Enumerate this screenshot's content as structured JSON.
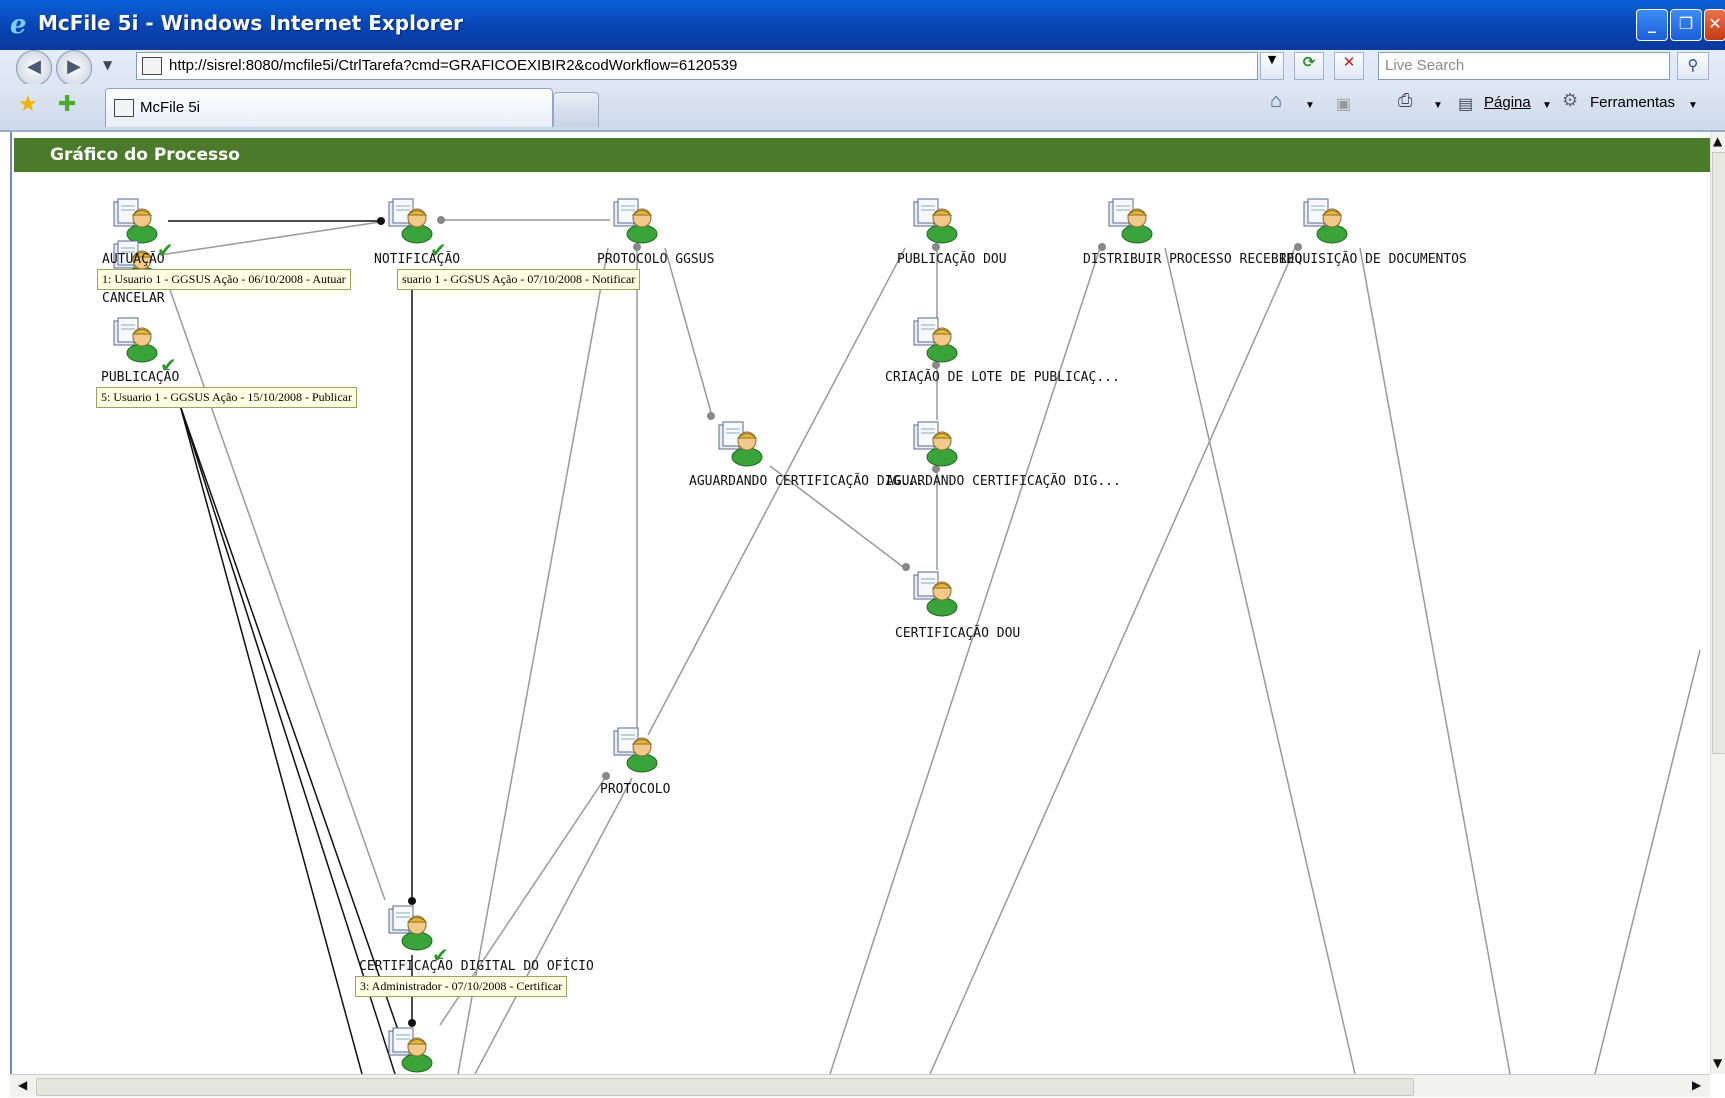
{
  "window": {
    "title": "McFile 5i - Windows Internet Explorer"
  },
  "browser": {
    "url": "http://sisrel:8080/mcfile5i/CtrlTarefa?cmd=GRAFICOEXIBIR2&codWorkflow=6120539",
    "search_placeholder": "Live Search",
    "tab_label": "McFile 5i",
    "menu_pagina": "Página",
    "menu_ferramentas": "Ferramentas"
  },
  "page": {
    "header": "Gráfico do Processo"
  },
  "nodes": [
    {
      "label": "AUTUAÇÃO"
    },
    {
      "label": "NOTIFICAÇÃO"
    },
    {
      "label": "PROTOCOLO GGSUS"
    },
    {
      "label": "PUBLICAÇÃO DOU"
    },
    {
      "label": "DISTRIBUIR PROCESSO RECEBIDO"
    },
    {
      "label": "REQUISIÇÃO DE DOCUMENTOS"
    },
    {
      "label": "CANCELAR"
    },
    {
      "label": "PUBLICAÇÃO"
    },
    {
      "label": "CRIAÇÃO DE LOTE DE PUBLICAÇ..."
    },
    {
      "label": "AGUARDANDO CERTIFICAÇÃO DIG..."
    },
    {
      "label": "AGUARDANDO CERTIFICAÇÃO DIG..."
    },
    {
      "label": "CERTIFICAÇÃO DOU"
    },
    {
      "label": "PROTOCOLO"
    },
    {
      "label": "CERTIFICAÇÃO DIGITAL DO OFÍCIO"
    }
  ],
  "tooltips": [
    "1: Usuario 1 - GGSUS Ação - 06/10/2008 - Autuar",
    "suario 1 - GGSUS Ação - 07/10/2008 - Notificar",
    "5: Usuario 1 - GGSUS Ação - 15/10/2008 - Publicar",
    "3: Administrador - 07/10/2008 - Certificar"
  ]
}
